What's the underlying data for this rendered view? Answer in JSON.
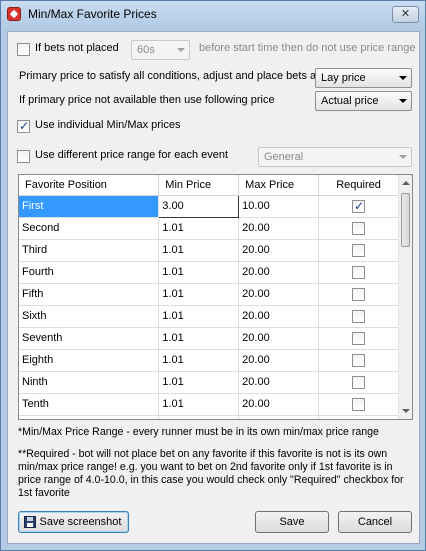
{
  "window": {
    "title": "Min/Max Favorite Prices",
    "close_glyph": "✕"
  },
  "options": {
    "bets_not_placed": {
      "label": "If bets not placed",
      "checked": false,
      "time_value": "60s",
      "suffix": "before start time then do not use price range"
    },
    "primary_price": {
      "label": "Primary price to satisfy all conditions, adjust and place bets at",
      "value": "Lay price"
    },
    "fallback_price": {
      "label": "If primary price not available then use following price",
      "value": "Actual price"
    },
    "use_individual": {
      "label": "Use individual Min/Max prices",
      "checked": true
    },
    "different_range": {
      "label": "Use different price range for each event",
      "checked": false,
      "value": "General"
    }
  },
  "table": {
    "columns": [
      "Favorite Position",
      "Min Price",
      "Max Price",
      "Required"
    ],
    "rows": [
      {
        "position": "First",
        "min": "3.00",
        "max": "10.00",
        "required": true
      },
      {
        "position": "Second",
        "min": "1.01",
        "max": "20.00",
        "required": false
      },
      {
        "position": "Third",
        "min": "1.01",
        "max": "20.00",
        "required": false
      },
      {
        "position": "Fourth",
        "min": "1.01",
        "max": "20.00",
        "required": false
      },
      {
        "position": "Fifth",
        "min": "1.01",
        "max": "20.00",
        "required": false
      },
      {
        "position": "Sixth",
        "min": "1.01",
        "max": "20.00",
        "required": false
      },
      {
        "position": "Seventh",
        "min": "1.01",
        "max": "20.00",
        "required": false
      },
      {
        "position": "Eighth",
        "min": "1.01",
        "max": "20.00",
        "required": false
      },
      {
        "position": "Ninth",
        "min": "1.01",
        "max": "20.00",
        "required": false
      },
      {
        "position": "Tenth",
        "min": "1.01",
        "max": "20.00",
        "required": false
      },
      {
        "position": "",
        "min": "",
        "max": "",
        "required": false
      }
    ]
  },
  "notes": {
    "range_note": "*Min/Max Price Range - every runner must be in its own min/max price range",
    "required_note": "**Required - bot will not place bet on any favorite if this favorite is not is its own min/max price range! e.g. you want to bet on 2nd favorite only if 1st favorite is in price range of 4.0-10.0, in this case you would check only \"Required\" checkbox for 1st favorite"
  },
  "buttons": {
    "save_screenshot": "Save screenshot",
    "save": "Save",
    "cancel": "Cancel"
  },
  "icons": {
    "app": "app-logo-icon",
    "save": "floppy-disk-icon",
    "close": "close-icon"
  }
}
